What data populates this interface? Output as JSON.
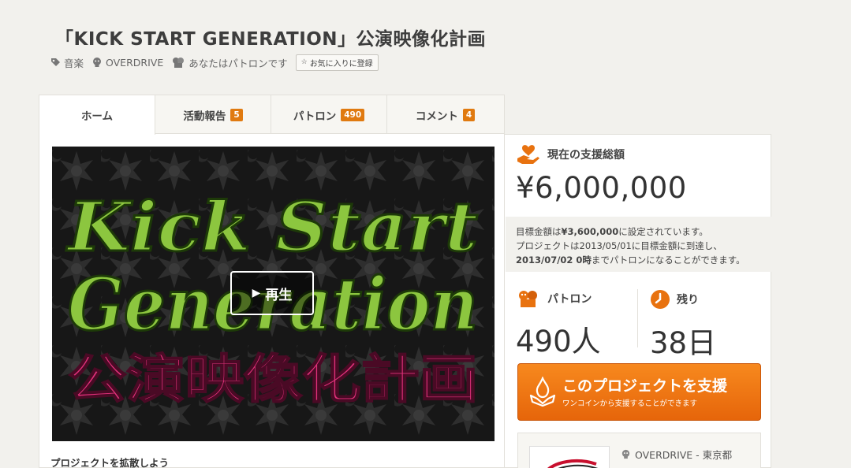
{
  "project": {
    "title": "「KICK START GENERATION」公演映像化計画",
    "category": "音楽",
    "owner": "OVERDRIVE",
    "patron_status": "あなたはパトロンです",
    "favorite_label": "お気に入りに登録"
  },
  "tabs": [
    {
      "label": "ホーム",
      "badge": ""
    },
    {
      "label": "活動報告",
      "badge": "5"
    },
    {
      "label": "パトロン",
      "badge": "490"
    },
    {
      "label": "コメント",
      "badge": "4"
    }
  ],
  "video": {
    "line1": "Kick Start",
    "line2": "Generation",
    "line3": "公演映像化計画",
    "play_label": "再生"
  },
  "spread_label": "プロジェクトを拡散しよう",
  "funding": {
    "heading": "現在の支援総額",
    "amount": "¥6,000,000",
    "goal_prefix": "目標金額は",
    "goal_amount": "¥3,600,000",
    "goal_suffix": "に設定されています。",
    "reached_text": "プロジェクトは2013/05/01に目標金額に到達し、",
    "deadline": "2013/07/02 0時",
    "deadline_suffix": "までパトロンになることができます。"
  },
  "patrons": {
    "heading": "パトロン",
    "value": "490人"
  },
  "remaining": {
    "heading": "残り",
    "value": "38日"
  },
  "cta": {
    "label": "このプロジェクトを支援",
    "sub": "ワンコインから支援することができます"
  },
  "owner_box": {
    "name": "OVERDRIVE - 東京都"
  },
  "colors": {
    "accent": "#e8720f",
    "badge": "#e07a10",
    "green_text": "#8cc63f",
    "pink_text": "#e0317a"
  }
}
